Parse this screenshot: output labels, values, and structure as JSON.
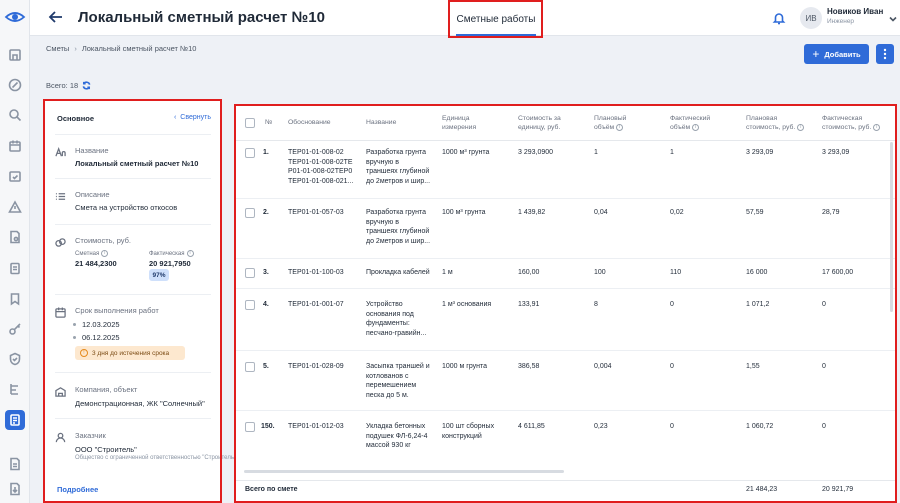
{
  "header": {
    "title": "Локальный сметный расчет №10",
    "tab_label": "Сметные работы",
    "user": {
      "initials": "ИВ",
      "name": "Новиков Иван",
      "role": "Инженер"
    }
  },
  "breadcrumbs": [
    "Сметы",
    "Локальный сметный расчет №10"
  ],
  "actions": {
    "add_label": "Добавить"
  },
  "total_label": "Всего: 18",
  "info_panel": {
    "title": "Основное",
    "collapse_label": "Свернуть",
    "name": {
      "label": "Название",
      "value": "Локальный сметный расчет №10"
    },
    "description": {
      "label": "Описание",
      "value": "Смета на устройство откосов"
    },
    "cost": {
      "label": "Стоимость, руб.",
      "estimated_label": "Сметная",
      "estimated_value": "21 484,2300",
      "actual_label": "Фактическая",
      "actual_value": "20 921,7950",
      "percent": "97%"
    },
    "deadline": {
      "label": "Срок выполнения работ",
      "start": "12.03.2025",
      "end": "06.12.2025",
      "warning": "3 дня до истечения срока"
    },
    "company": {
      "label": "Компания, объект",
      "value": "Демонстрационная, ЖК \"Солнечный\""
    },
    "customer": {
      "label": "Заказчик",
      "value": "ООО \"Строитель\"",
      "sub": "Общество с ограниченной ответственностью \"Строитель\""
    },
    "more_label": "Подробнее"
  },
  "table": {
    "headers": {
      "num": "№",
      "basis": "Обоснование",
      "name": "Название",
      "unit": [
        "Единица",
        "измерения"
      ],
      "unit_cost": [
        "Стоимость за",
        "единицу, руб."
      ],
      "plan_volume": [
        "Плановый",
        "объём"
      ],
      "fact_volume": [
        "Фактический",
        "объём"
      ],
      "plan_cost": [
        "Плановая",
        "стоимость, руб."
      ],
      "fact_cost": [
        "Фактическая",
        "стоимость, руб."
      ]
    },
    "rows": [
      {
        "num": "1.",
        "basis": [
          "ТЕР01-01-008-02",
          "ТЕР01-01-008-02ТЕ",
          "Р01-01-008-02ТЕР0",
          "ТЕР01-01-008-021..."
        ],
        "name": [
          "Разработка грунта",
          "вручную в",
          "траншеях глубиной",
          "до 2метров и шир..."
        ],
        "unit": "1000 м³ грунта",
        "unit_cost": "3 293,0900",
        "plan_volume": "1",
        "fact_volume": "1",
        "plan_cost": "3 293,09",
        "fact_cost": "3 293,09"
      },
      {
        "num": "2.",
        "basis": [
          "ТЕР01-01-057-03"
        ],
        "name": [
          "Разработка грунта",
          "вручную в",
          "траншеях глубиной",
          "до 2метров и шир..."
        ],
        "unit": "100 м³ грунта",
        "unit_cost": "1 439,82",
        "plan_volume": "0,04",
        "fact_volume": "0,02",
        "plan_cost": "57,59",
        "fact_cost": "28,79"
      },
      {
        "num": "3.",
        "basis": [
          "ТЕР01-01-100-03"
        ],
        "name": [
          "Прокладка кабелей"
        ],
        "unit": "1 м",
        "unit_cost": "160,00",
        "plan_volume": "100",
        "fact_volume": "110",
        "plan_cost": "16 000",
        "fact_cost": "17 600,00"
      },
      {
        "num": "4.",
        "basis": [
          "ТЕР01-01-001-07"
        ],
        "name": [
          "Устройство",
          "основания под",
          "фундаменты:",
          "песчано-гравийн..."
        ],
        "unit": "1 м³ основания",
        "unit_cost": "133,91",
        "plan_volume": "8",
        "fact_volume": "0",
        "plan_cost": "1 071,2",
        "fact_cost": "0"
      },
      {
        "num": "5.",
        "basis": [
          "ТЕР01-01-028-09"
        ],
        "name": [
          "Засыпка траншей и",
          "котлованов с",
          "перемешением",
          "песка до 5 м."
        ],
        "unit": "1000 м грунта",
        "unit_cost": "386,58",
        "plan_volume": "0,004",
        "fact_volume": "0",
        "plan_cost": "1,55",
        "fact_cost": "0"
      },
      {
        "num": "150.",
        "basis": [
          "ТЕР01-01-012-03"
        ],
        "name": [
          "Укладка бетонных",
          "подушек ФЛ-6,24-4",
          "массой 930 кг"
        ],
        "unit": "100 шт сборных конструкций",
        "unit_cost": "4 611,85",
        "plan_volume": "0,23",
        "fact_volume": "0",
        "plan_cost": "1 060,72",
        "fact_cost": "0"
      }
    ],
    "footer": {
      "label": "Всего по смете",
      "plan_cost": "21 484,23",
      "fact_cost": "20 921,79"
    }
  }
}
